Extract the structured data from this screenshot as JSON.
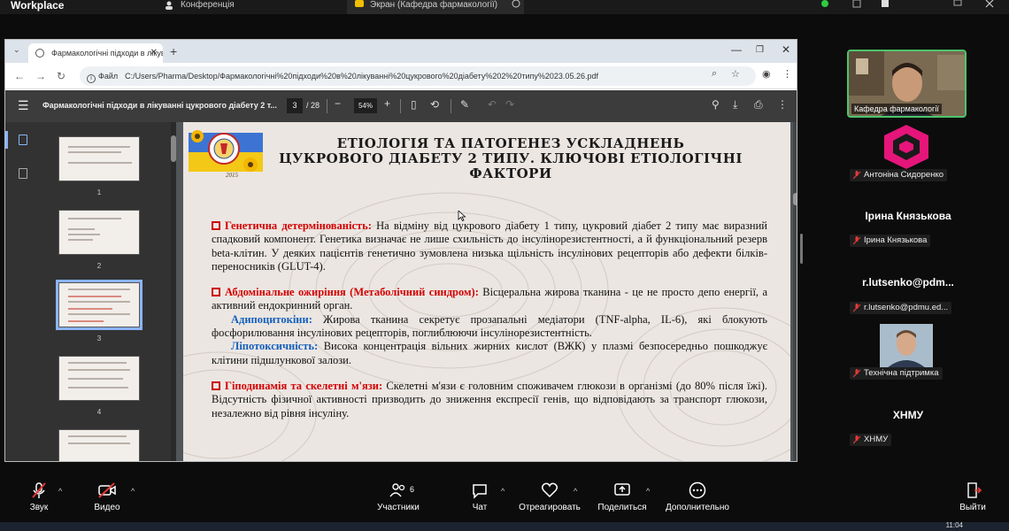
{
  "app": {
    "name": "Workplace"
  },
  "top_tabs": [
    {
      "label": "Конференція"
    },
    {
      "label": "Экран (Кафедра фармакології)"
    }
  ],
  "browser": {
    "tab_title": "Фармакологічні підходи в лікув",
    "address_label": "Файл",
    "url": "C:/Users/Pharma/Desktop/Фармакологічні%20підходи%20в%20лікуванні%20цукрового%20діабету%202%20типу%2023.05.26.pdf"
  },
  "pdf": {
    "title": "Фармакологічні підходи в лікуванні цукрового діабету 2 т...",
    "current_page": "3",
    "page_total": "/ 28",
    "zoom": "54%",
    "thumbnails": [
      {
        "num": "1"
      },
      {
        "num": "2"
      },
      {
        "num": "3"
      },
      {
        "num": "4"
      }
    ]
  },
  "slide": {
    "logo_year": "2015",
    "title_line1": "ЕТІОЛОГІЯ ТА ПАТОГЕНЕЗ УСКЛАДНЕНЬ",
    "title_line2": "ЦУКРОВОГО ДІАБЕТУ 2 ТИПУ. КЛЮЧОВІ ЕТІОЛОГІЧНІ ФАКТОРИ",
    "s1_head": "Генетична детермінованість:",
    "s1_text": " На відміну від цукрового діабету 1 типу, цукровий діабет 2 типу має виразний спадковий компонент. Генетика визначає не лише схильність до інсулінорезистентності, а й функціональний резерв beta-клітин. У деяких пацієнтів генетично зумовлена низька щільність інсулінових рецепторів або дефекти білків-переносників (GLUT-4).",
    "s2_head": "Абдомінальне ожиріння (Метаболічний синдром):",
    "s2_text": " Вісцеральна жирова тканина - це не просто депо енергії, а активний ендокринний орган.",
    "s2a_head": "Адипоцитокіни:",
    "s2a_text": " Жирова тканина секретує прозапальні медіатори (TNF-alpha, IL-6), які блокують фосфорилювання інсулінових рецепторів, поглиблюючи інсулінорезистентність.",
    "s2b_head": "Ліпотоксичність:",
    "s2b_text": " Висока концентрація вільних жирних кислот (ВЖК) у плазмі безпосередньо пошкоджує клітини підшлункової залози.",
    "s3_head": "Гіподинамія та скелетні м'язи:",
    "s3_text": " Скелетні м'язи є головним споживачем глюкози в організмі (до 80% після їжі). Відсутність фізичної активності призводить до зниження експресії генів, що відповідають за транспорт глюкози, незалежно від рівня інсуліну."
  },
  "participants": {
    "host_tile": "Кафедра фармакології",
    "items": [
      {
        "label": "Антоніна Сидоренко"
      },
      {
        "name": "Ірина Князькова",
        "label": "Ірина Князькова"
      },
      {
        "name": "r.lutsenko@pdm...",
        "label": "r.lutsenko@pdmu.ed..."
      },
      {
        "label": "Технічна підтримка"
      },
      {
        "name": "ХНМУ",
        "label": "ХНМУ"
      }
    ]
  },
  "toolbar": {
    "sound": "Звук",
    "video": "Видео",
    "participants": "Участники",
    "participants_count": "6",
    "chat": "Чат",
    "react": "Отреагировать",
    "share": "Поделиться",
    "more": "Дополнительно",
    "leave": "Выйти"
  },
  "taskbar": {
    "clock": "11:04"
  },
  "colors": {
    "accent_red": "#d40000",
    "accent_blue": "#1560bd",
    "active_speaker": "#4cc46c"
  }
}
